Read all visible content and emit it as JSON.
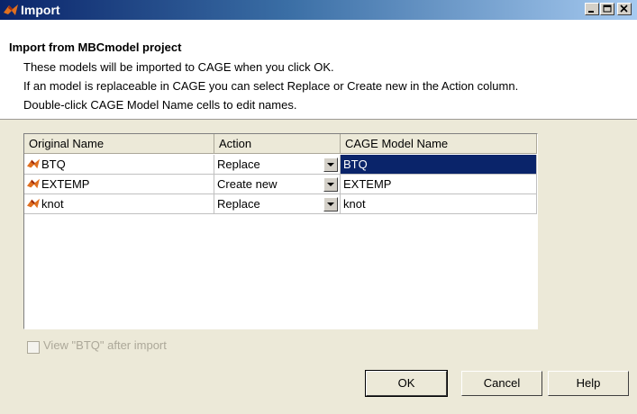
{
  "window": {
    "title": "Import"
  },
  "header": {
    "title": "Import from MBCmodel project",
    "lines": [
      "These models will be imported to CAGE when you click OK.",
      "If an model is replaceable in CAGE you can select Replace or Create new in the Action column.",
      "Double-click CAGE Model Name cells to edit names."
    ]
  },
  "table": {
    "columns": [
      "Original Name",
      "Action",
      "CAGE Model Name"
    ],
    "rows": [
      {
        "original": "BTQ",
        "action": "Replace",
        "cage_name": "BTQ",
        "selected": true
      },
      {
        "original": "EXTEMP",
        "action": "Create new",
        "cage_name": "EXTEMP",
        "selected": false
      },
      {
        "original": "knot",
        "action": "Replace",
        "cage_name": "knot",
        "selected": false
      }
    ]
  },
  "options": {
    "view_after_import": "View \"BTQ\" after import"
  },
  "buttons": {
    "ok": "OK",
    "cancel": "Cancel",
    "help": "Help"
  },
  "icons": {
    "title": "matlab-logo-icon",
    "row": "matlab-logo-icon",
    "dropdown": "chevron-down-icon",
    "cursor": "mouse-cursor-icon"
  },
  "colors": {
    "selection": "#0a246a",
    "title_bar": "#0a246a"
  }
}
